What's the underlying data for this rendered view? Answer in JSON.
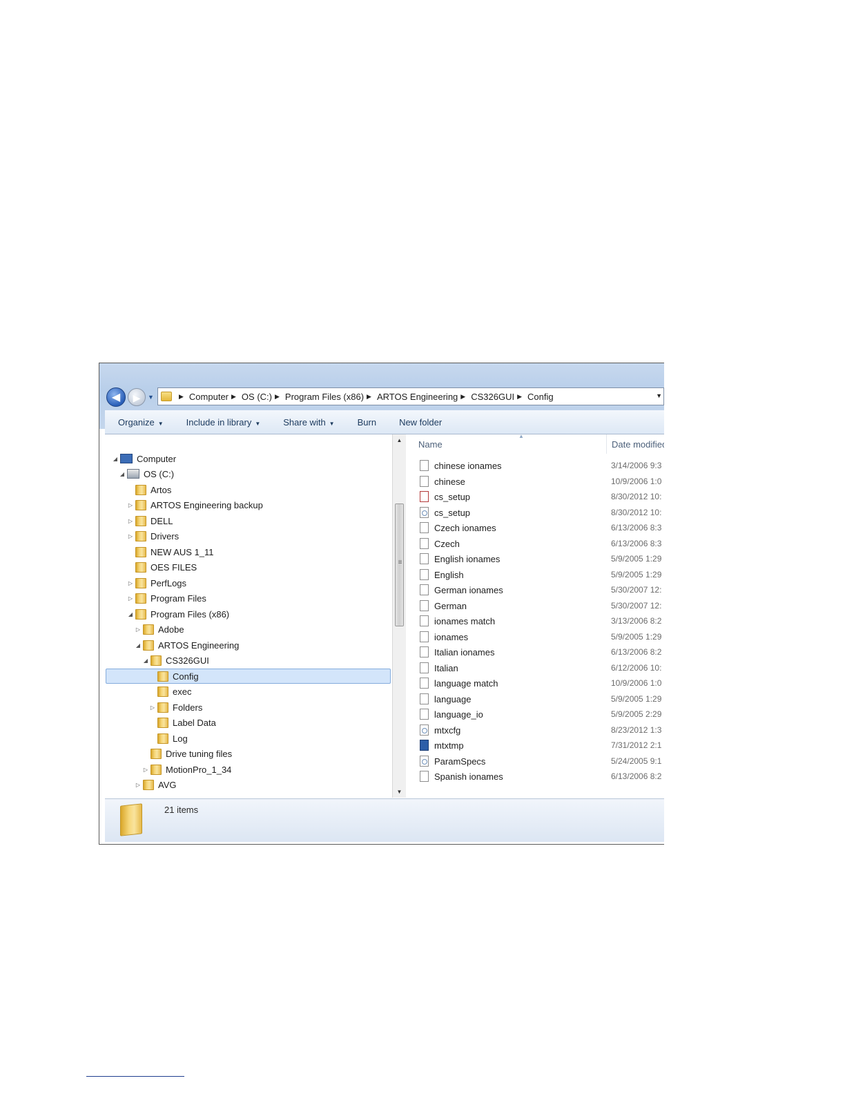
{
  "address": {
    "crumbs": [
      "Computer",
      "OS (C:)",
      "Program Files (x86)",
      "ARTOS Engineering",
      "CS326GUI",
      "Config"
    ]
  },
  "toolbar": {
    "organize": "Organize",
    "include": "Include in library",
    "share": "Share with",
    "burn": "Burn",
    "new_folder": "New folder"
  },
  "tree": {
    "computer": "Computer",
    "os": "OS (C:)",
    "items": [
      "Artos",
      "ARTOS Engineering backup",
      "DELL",
      "Drivers",
      "NEW AUS 1_11",
      "OES FILES",
      "PerfLogs",
      "Program Files",
      "Program Files (x86)",
      "Adobe",
      "ARTOS Engineering",
      "CS326GUI",
      "Config",
      "exec",
      "Folders",
      "Label Data",
      "Log",
      "Drive tuning files",
      "MotionPro_1_34",
      "AVG"
    ]
  },
  "columns": {
    "name": "Name",
    "date": "Date modified"
  },
  "files": [
    {
      "name": "chinese ionames",
      "date": "3/14/2006 9:3"
    },
    {
      "name": "chinese",
      "date": "10/9/2006 1:0"
    },
    {
      "name": "cs_setup",
      "date": "8/30/2012 10:"
    },
    {
      "name": "cs_setup",
      "date": "8/30/2012 10:"
    },
    {
      "name": "Czech ionames",
      "date": "6/13/2006 8:3"
    },
    {
      "name": "Czech",
      "date": "6/13/2006 8:3"
    },
    {
      "name": "English ionames",
      "date": "5/9/2005 1:29"
    },
    {
      "name": "English",
      "date": "5/9/2005 1:29"
    },
    {
      "name": "German ionames",
      "date": "5/30/2007 12:"
    },
    {
      "name": "German",
      "date": "5/30/2007 12:"
    },
    {
      "name": "ionames match",
      "date": "3/13/2006 8:2"
    },
    {
      "name": "ionames",
      "date": "5/9/2005 1:29"
    },
    {
      "name": "Italian ionames",
      "date": "6/13/2006 8:2"
    },
    {
      "name": "Italian",
      "date": "6/12/2006 10:"
    },
    {
      "name": "language match",
      "date": "10/9/2006 1:0"
    },
    {
      "name": "language",
      "date": "5/9/2005 1:29"
    },
    {
      "name": "language_io",
      "date": "5/9/2005 2:29"
    },
    {
      "name": "mtxcfg",
      "date": "8/23/2012 1:3"
    },
    {
      "name": "mtxtmp",
      "date": "7/31/2012 2:1"
    },
    {
      "name": "ParamSpecs",
      "date": "5/24/2005 9:1"
    },
    {
      "name": "Spanish ionames",
      "date": "6/13/2006 8:2"
    }
  ],
  "status": {
    "count": "21 items"
  }
}
